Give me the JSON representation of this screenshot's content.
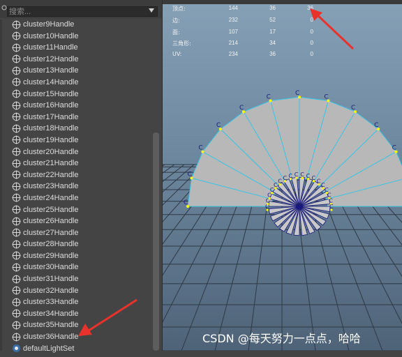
{
  "search": {
    "placeholder": "搜索..."
  },
  "outliner_items": [
    "cluster9Handle",
    "cluster10Handle",
    "cluster11Handle",
    "cluster12Handle",
    "cluster13Handle",
    "cluster14Handle",
    "cluster15Handle",
    "cluster16Handle",
    "cluster17Handle",
    "cluster18Handle",
    "cluster19Handle",
    "cluster20Handle",
    "cluster21Handle",
    "cluster22Handle",
    "cluster23Handle",
    "cluster24Handle",
    "cluster25Handle",
    "cluster26Handle",
    "cluster27Handle",
    "cluster28Handle",
    "cluster29Handle",
    "cluster30Handle",
    "cluster31Handle",
    "cluster32Handle",
    "cluster33Handle",
    "cluster34Handle",
    "cluster35Handle",
    "cluster36Handle"
  ],
  "last_item": "defaultLightSet",
  "icons": {
    "cluster": "crosshair-circle-icon",
    "lightset": "lightset-icon"
  },
  "hud": {
    "rows": [
      {
        "label": "顶点:",
        "v1": "144",
        "v2": "36",
        "v3": "36"
      },
      {
        "label": "边:",
        "v1": "232",
        "v2": "52",
        "v3": "0"
      },
      {
        "label": "面:",
        "v1": "107",
        "v2": "17",
        "v3": "0"
      },
      {
        "label": "三角形:",
        "v1": "214",
        "v2": "34",
        "v3": "0"
      },
      {
        "label": "UV:",
        "v1": "234",
        "v2": "36",
        "v3": "0"
      }
    ]
  },
  "watermark": "CSDN @每天努力一点点，哈哈",
  "colors": {
    "arrow": "#e8322b",
    "mesh": "#b8b8b8",
    "wire": "#37c4e6",
    "vertex": "#ffff00",
    "cluster_marker": "#1a1a7a"
  }
}
